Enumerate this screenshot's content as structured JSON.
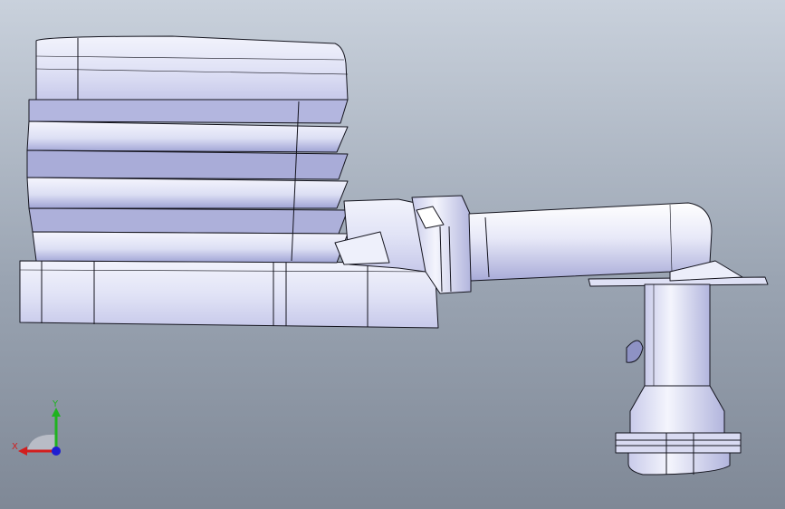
{
  "viewport": {
    "background_top": "#c9d1dc",
    "background_bottom": "#7f8896"
  },
  "model": {
    "body_fill": "#e6e8f8",
    "shade_fill": "#a9acd8",
    "edge_color": "#14141e"
  },
  "triad": {
    "x_label": "X",
    "y_label": "Y",
    "x_color": "#d21e1e",
    "y_color": "#1fb31f",
    "z_color": "#1e1ed2"
  }
}
